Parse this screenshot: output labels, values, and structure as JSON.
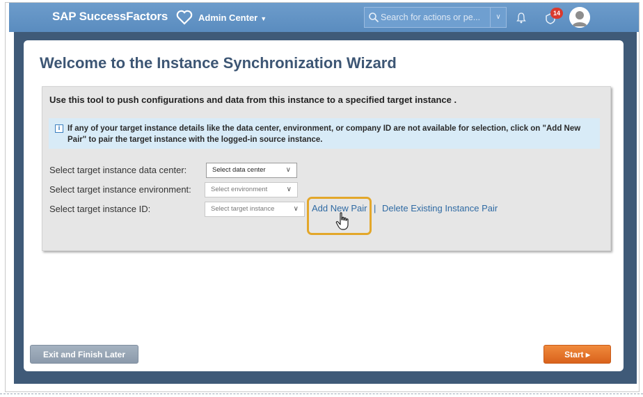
{
  "header": {
    "brand": "SAP SuccessFactors",
    "admin_menu": "Admin Center",
    "search_placeholder": "Search for actions or pe...",
    "notification_count": "14"
  },
  "page": {
    "title": "Welcome to the Instance Synchronization Wizard",
    "intro": "Use this tool to push configurations and data from this instance to a specified target instance .",
    "info": "If any of your target instance details like the data center, environment, or company ID are not available for selection, click on \"Add New Pair\" to pair the target instance with the logged-in source instance."
  },
  "form": {
    "data_center_label": "Select target instance data center:",
    "data_center_value": "Select data center",
    "environment_label": "Select target instance environment:",
    "environment_value": "Select environment",
    "instance_label": "Select target instance ID:",
    "instance_value": "Select target instance",
    "add_pair": "Add New Pair",
    "separator": "|",
    "delete_pair": "Delete Existing Instance Pair"
  },
  "footer": {
    "exit_label": "Exit and Finish Later",
    "start_label": "Start ▸"
  },
  "colors": {
    "topbar": "#5f91c4",
    "accent_orange": "#e3a72a",
    "start_button": "#e2712a",
    "link": "#2f6aa3"
  },
  "icons": [
    "heart-icon",
    "search-icon",
    "bell-icon",
    "notification-icon",
    "avatar-icon",
    "info-icon",
    "hand-cursor-icon",
    "chevron-down-icon"
  ]
}
